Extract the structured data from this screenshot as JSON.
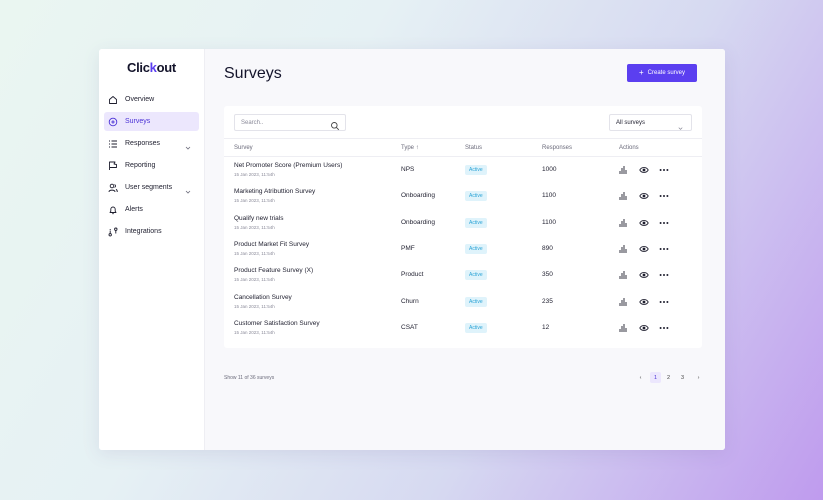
{
  "app": {
    "logo_text_a": "Clic",
    "logo_text_k": "k",
    "logo_text_b": "out"
  },
  "sidebar": {
    "items": [
      {
        "label": "Overview",
        "icon": "home-icon"
      },
      {
        "label": "Surveys",
        "icon": "plus-circle-icon",
        "active": true
      },
      {
        "label": "Responses",
        "icon": "list-icon",
        "expandable": true
      },
      {
        "label": "Reporting",
        "icon": "flag-icon"
      },
      {
        "label": "User segments",
        "icon": "users-icon",
        "expandable": true
      },
      {
        "label": "Alerts",
        "icon": "bell-icon"
      },
      {
        "label": "Integrations",
        "icon": "integrations-icon"
      }
    ]
  },
  "header": {
    "title": "Surveys",
    "create_label": "Create survey",
    "create_icon": "+"
  },
  "toolbar": {
    "search_placeholder": "Search..",
    "filter_value": "All surveys"
  },
  "table": {
    "columns": {
      "survey": "Survey",
      "type": "Type",
      "type_sort": "↑",
      "status": "Status",
      "responses": "Responses",
      "actions": "Actions"
    },
    "rows": [
      {
        "name": "Net Promoter Score (Premium Users)",
        "date": "15 Jan 2023, 11:54h",
        "type": "NPS",
        "status": "Active",
        "responses": "1000"
      },
      {
        "name": "Marketing Atributtion Survey",
        "date": "15 Jan 2023, 11:54h",
        "type": "Onboarding",
        "status": "Active",
        "responses": "1100"
      },
      {
        "name": "Qualify new trials",
        "date": "15 Jan 2023, 11:54h",
        "type": "Onboarding",
        "status": "Active",
        "responses": "1100"
      },
      {
        "name": "Product Market Fit Survey",
        "date": "15 Jan 2023, 11:54h",
        "type": "PMF",
        "status": "Active",
        "responses": "890"
      },
      {
        "name": "Product Feature Survey (X)",
        "date": "15 Jan 2023, 11:54h",
        "type": "Product",
        "status": "Active",
        "responses": "350"
      },
      {
        "name": "Cancellation Survey",
        "date": "15 Jan 2023, 11:54h",
        "type": "Churn",
        "status": "Active",
        "responses": "235"
      },
      {
        "name": "Customer Satisfaction Survey",
        "date": "15 Jan 2023, 11:54h",
        "type": "CSAT",
        "status": "Active",
        "responses": "12"
      }
    ]
  },
  "footer": {
    "showing": "Show 11 of 36 surveys",
    "pages": [
      "1",
      "2",
      "3"
    ],
    "current_page": "1",
    "prev": "‹",
    "next": "›"
  },
  "colors": {
    "accent": "#5b3ff0",
    "active_bg": "#ece7fd",
    "badge_bg": "#dff3fb",
    "badge_text": "#2aa3d6"
  }
}
